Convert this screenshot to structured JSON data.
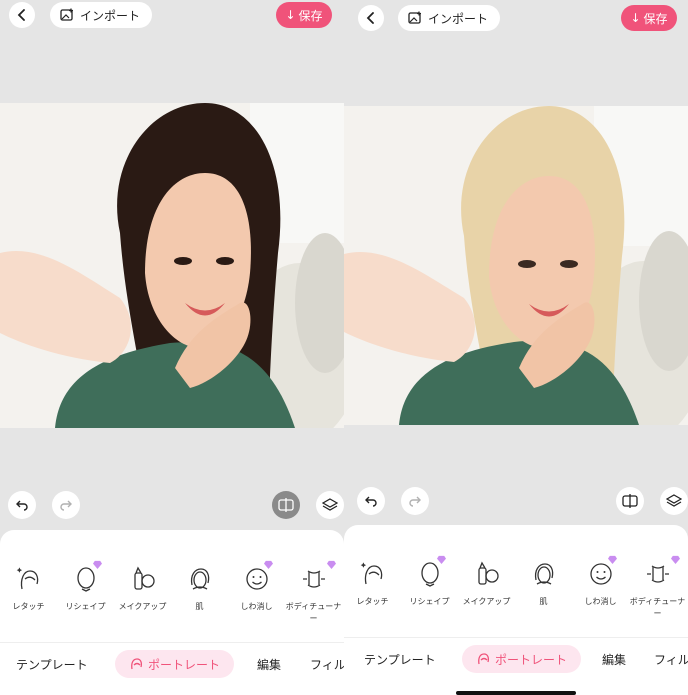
{
  "left_screen": {
    "header": {
      "import_label": "インポート",
      "save_label": "保存"
    },
    "tools": [
      {
        "label": "レタッチ",
        "premium": false
      },
      {
        "label": "リシェイプ",
        "premium": true
      },
      {
        "label": "メイクアップ",
        "premium": false
      },
      {
        "label": "肌",
        "premium": false
      },
      {
        "label": "しわ消し",
        "premium": true
      },
      {
        "label": "ボディチューナー",
        "premium": true
      }
    ],
    "tabs": {
      "template": "テンプレート",
      "portrait": "ポートレート",
      "edit": "編集",
      "filter": "フィル"
    },
    "hair_color": "#2a1a14",
    "compare_active": true
  },
  "right_screen": {
    "header": {
      "import_label": "インポート",
      "save_label": "保存"
    },
    "tools": [
      {
        "label": "レタッチ",
        "premium": false
      },
      {
        "label": "リシェイプ",
        "premium": true
      },
      {
        "label": "メイクアップ",
        "premium": false
      },
      {
        "label": "肌",
        "premium": false
      },
      {
        "label": "しわ消し",
        "premium": true
      },
      {
        "label": "ボディチューナー",
        "premium": true
      }
    ],
    "tabs": {
      "template": "テンプレート",
      "portrait": "ポートレート",
      "edit": "編集",
      "filter": "フィル"
    },
    "hair_color": "#e8d3a8",
    "compare_active": false
  },
  "colors": {
    "accent": "#f0537a",
    "accent_soft": "#fde6ef",
    "shirt": "#3f6e5a",
    "skin": "#f3c9ae"
  }
}
